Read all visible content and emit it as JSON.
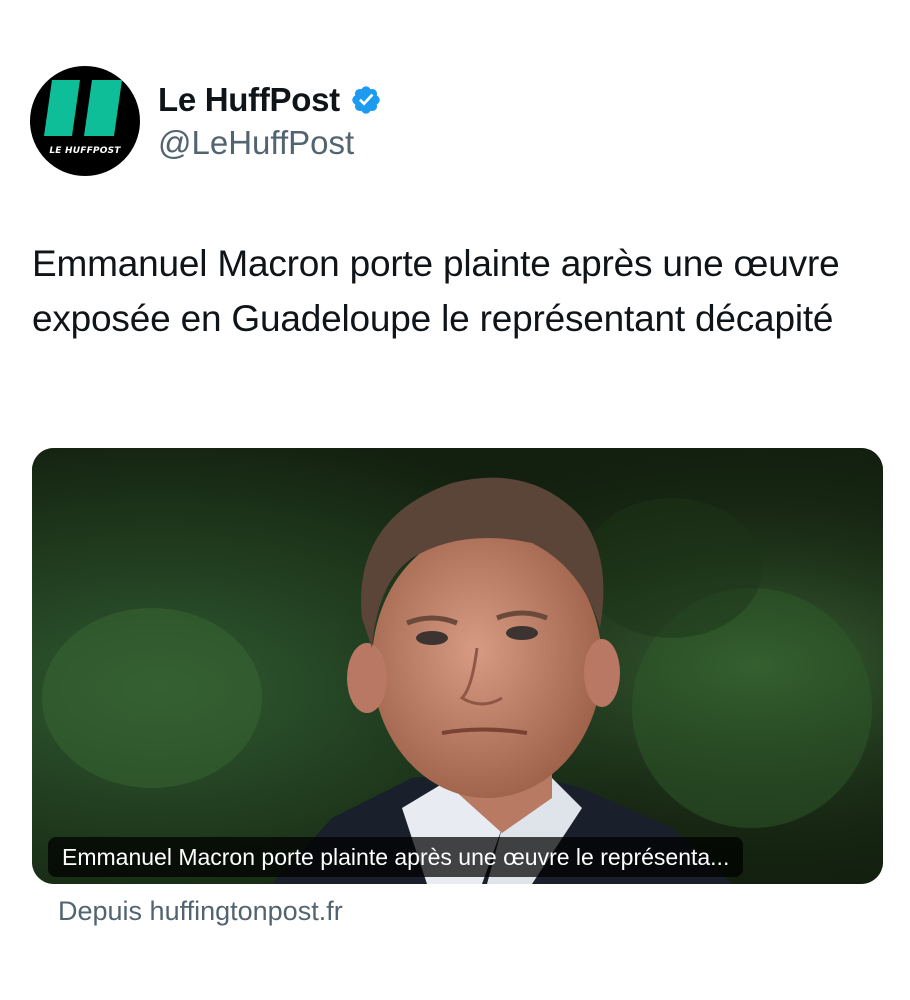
{
  "account": {
    "avatar_label": "LE HUFFPOST",
    "display_name": "Le HuffPost",
    "handle": "@LeHuffPost",
    "verified_icon": "verified-badge-icon"
  },
  "tweet": {
    "text": "Emmanuel Macron porte plainte après une œuvre exposée en Guadeloupe le représentant décapité"
  },
  "card": {
    "caption": "Emmanuel Macron porte plainte après une œuvre le représenta...",
    "source": "Depuis huffingtonpost.fr"
  },
  "colors": {
    "brand_accent": "#0dbe98",
    "verified_blue": "#1d9bf0",
    "secondary_text": "#536471"
  }
}
